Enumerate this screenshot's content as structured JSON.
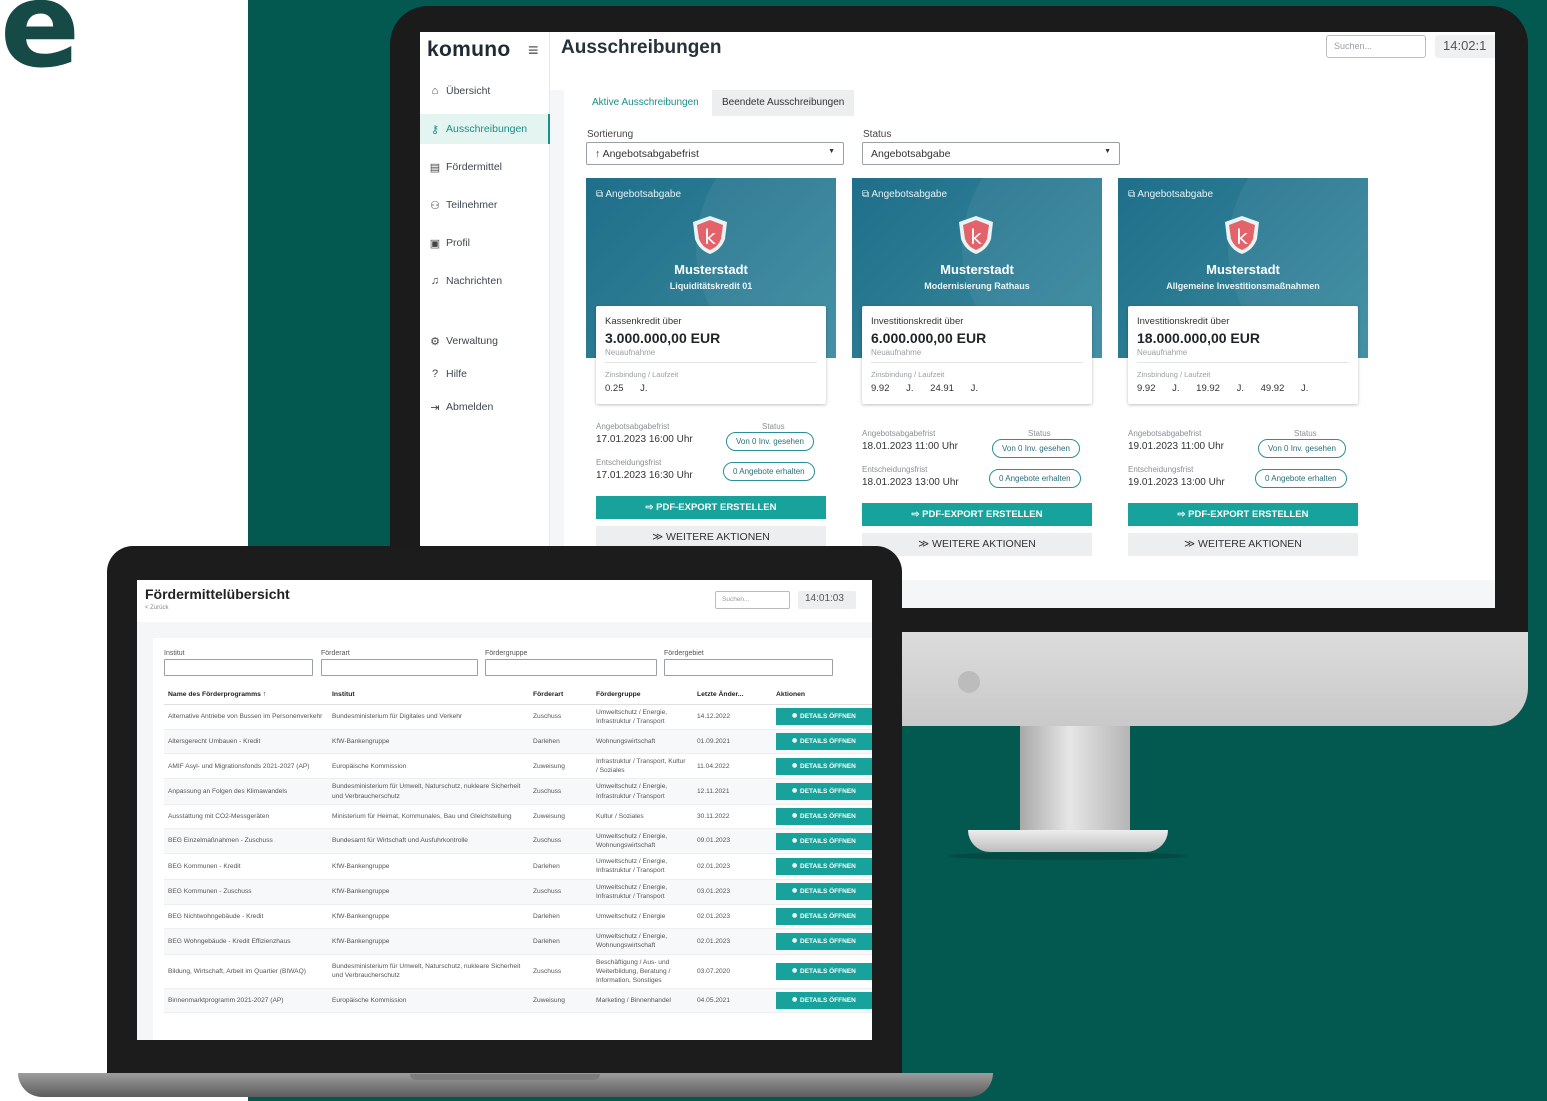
{
  "decor": {
    "corner_glyph": "e"
  },
  "desktop": {
    "logo": "komuno",
    "page_title": "Ausschreibungen",
    "search_placeholder": "Suchen...",
    "clock": "14:02:1",
    "nav": [
      {
        "label": "Übersicht",
        "icon": "home-icon"
      },
      {
        "label": "Ausschreibungen",
        "icon": "key-icon",
        "active": true
      },
      {
        "label": "Fördermittel",
        "icon": "document-icon"
      },
      {
        "label": "Teilnehmer",
        "icon": "users-icon"
      },
      {
        "label": "Profil",
        "icon": "id-card-icon"
      },
      {
        "label": "Nachrichten",
        "icon": "bell-icon"
      },
      {
        "label": "Verwaltung",
        "icon": "settings-icon"
      },
      {
        "label": "Hilfe",
        "icon": "help-icon"
      },
      {
        "label": "Abmelden",
        "icon": "logout-icon"
      }
    ],
    "tabs": {
      "active": "Aktive Ausschreibungen",
      "ended": "Beendete Ausschreibungen"
    },
    "sort": {
      "label": "Sortierung",
      "value": "↑ Angebotsabgabefrist"
    },
    "status": {
      "label": "Status",
      "value": "Angebotsabgabe"
    },
    "cards": [
      {
        "type": "Angebotsabgabe",
        "city": "Musterstadt",
        "project": "Liquiditätskredit 01",
        "kind": "Kassenkredit über",
        "amount": "3.000.000,00 EUR",
        "sub": "Neuaufnahme",
        "zins_label": "Zinsbindung / Laufzeit",
        "zins": "0.25 J.",
        "frist_label": "Angebotsabgabefrist",
        "frist": "17.01.2023 16:00 Uhr",
        "status_label": "Status",
        "seen": "Von 0 Inv. gesehen",
        "decision_label": "Entscheidungsfrist",
        "decision": "17.01.2023 16:30 Uhr",
        "offers": "0 Angebote erhalten",
        "pdf": "PDF-EXPORT ERSTELLEN",
        "more": "WEITERE AKTIONEN"
      },
      {
        "type": "Angebotsabgabe",
        "city": "Musterstadt",
        "project": "Modernisierung Rathaus",
        "kind": "Investitionskredit über",
        "amount": "6.000.000,00 EUR",
        "sub": "Neuaufnahme",
        "zins_label": "Zinsbindung / Laufzeit",
        "zins": "9.92 J.  24.91 J.",
        "frist_label": "Angebotsabgabefrist",
        "frist": "18.01.2023 11:00 Uhr",
        "status_label": "Status",
        "seen": "Von 0 Inv. gesehen",
        "decision_label": "Entscheidungsfrist",
        "decision": "18.01.2023 13:00 Uhr",
        "offers": "0 Angebote erhalten",
        "pdf": "PDF-EXPORT ERSTELLEN",
        "more": "WEITERE AKTIONEN"
      },
      {
        "type": "Angebotsabgabe",
        "city": "Musterstadt",
        "project": "Allgemeine Investitionsmaßnahmen",
        "kind": "Investitionskredit über",
        "amount": "18.000.000,00 EUR",
        "sub": "Neuaufnahme",
        "zins_label": "Zinsbindung / Laufzeit",
        "zins": "9.92 J.  19.92 J.  49.92 J.",
        "frist_label": "Angebotsabgabefrist",
        "frist": "19.01.2023 11:00 Uhr",
        "status_label": "Status",
        "seen": "Von 0 Inv. gesehen",
        "decision_label": "Entscheidungsfrist",
        "decision": "19.01.2023 13:00 Uhr",
        "offers": "0 Angebote erhalten",
        "pdf": "PDF-EXPORT ERSTELLEN",
        "more": "WEITERE AKTIONEN"
      }
    ]
  },
  "laptop": {
    "title": "Fördermittelübersicht",
    "back": "< Zurück",
    "search_placeholder": "Suchen...",
    "clock": "14:01:03",
    "filters": [
      "Institut",
      "Förderart",
      "Fördergruppe",
      "Fördergebiet"
    ],
    "columns": [
      "Name des Förderprogramms ↑",
      "Institut",
      "Förderart",
      "Fördergruppe",
      "Letzte Änder...",
      "Aktionen"
    ],
    "button_label": "DETAILS ÖFFNEN",
    "rows": [
      {
        "name": "Alternative Antriebe von Bussen im Personenverkehr",
        "institut": "Bundesministerium für Digitales und Verkehr",
        "art": "Zuschuss",
        "gruppe": "Umweltschutz / Energie, Infrastruktur / Transport",
        "date": "14.12.2022"
      },
      {
        "name": "Altersgerecht Umbauen - Kredit",
        "institut": "KfW-Bankengruppe",
        "art": "Darlehen",
        "gruppe": "Wohnungswirtschaft",
        "date": "01.09.2021"
      },
      {
        "name": "AMIF Asyl- und Migrationsfonds 2021-2027 (AP)",
        "institut": "Europäische Kommission",
        "art": "Zuweisung",
        "gruppe": "Infrastruktur / Transport, Kultur / Soziales",
        "date": "11.04.2022"
      },
      {
        "name": "Anpassung an Folgen des Klimawandels",
        "institut": "Bundesministerium für Umwelt, Naturschutz, nukleare Sicherheit und Verbraucherschutz",
        "art": "Zuschuss",
        "gruppe": "Umweltschutz / Energie, Infrastruktur / Transport",
        "date": "12.11.2021"
      },
      {
        "name": "Ausstattung mit CO2-Messgeräten",
        "institut": "Ministerium für Heimat, Kommunales, Bau und Gleichstellung",
        "art": "Zuweisung",
        "gruppe": "Kultur / Soziales",
        "date": "30.11.2022"
      },
      {
        "name": "BEG Einzelmaßnahmen - Zuschuss",
        "institut": "Bundesamt für Wirtschaft und Ausfuhrkontrolle",
        "art": "Zuschuss",
        "gruppe": "Umweltschutz / Energie, Wohnungswirtschaft",
        "date": "09.01.2023"
      },
      {
        "name": "BEG Kommunen - Kredit",
        "institut": "KfW-Bankengruppe",
        "art": "Darlehen",
        "gruppe": "Umweltschutz / Energie, Infrastruktur / Transport",
        "date": "02.01.2023"
      },
      {
        "name": "BEG Kommunen - Zuschuss",
        "institut": "KfW-Bankengruppe",
        "art": "Zuschuss",
        "gruppe": "Umweltschutz / Energie, Infrastruktur / Transport",
        "date": "03.01.2023"
      },
      {
        "name": "BEG Nichtwohngebäude - Kredit",
        "institut": "KfW-Bankengruppe",
        "art": "Darlehen",
        "gruppe": "Umweltschutz / Energie",
        "date": "02.01.2023"
      },
      {
        "name": "BEG Wohngebäude - Kredit Effizienzhaus",
        "institut": "KfW-Bankengruppe",
        "art": "Darlehen",
        "gruppe": "Umweltschutz / Energie, Wohnungswirtschaft",
        "date": "02.01.2023"
      },
      {
        "name": "Bildung, Wirtschaft, Arbeit im Quartier (BIWAQ)",
        "institut": "Bundesministerium für Umwelt, Naturschutz, nukleare Sicherheit und Verbraucherschutz",
        "art": "Zuschuss",
        "gruppe": "Beschäftigung / Aus- und Weiterbildung, Beratung / Information, Sonstiges",
        "date": "03.07.2020"
      },
      {
        "name": "Binnenmarktprogramm 2021-2027 (AP)",
        "institut": "Europäische Kommission",
        "art": "Zuweisung",
        "gruppe": "Marketing / Binnenhandel",
        "date": "04.05.2021"
      }
    ]
  }
}
